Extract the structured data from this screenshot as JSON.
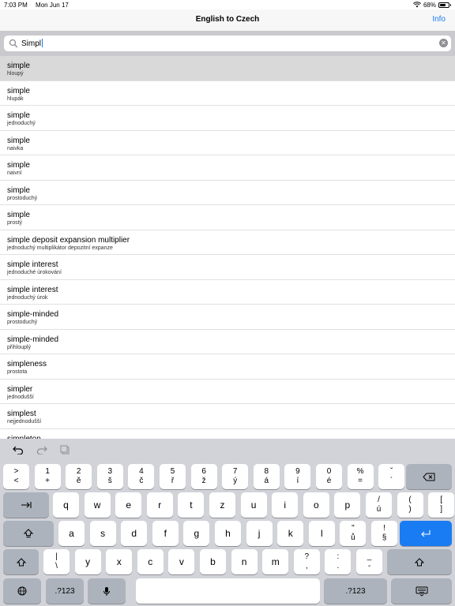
{
  "status_bar": {
    "time": "7:03 PM",
    "date": "Mon Jun 17",
    "battery": "68%",
    "battery_level": 0.68
  },
  "nav": {
    "title": "English to Czech",
    "info_label": "Info"
  },
  "search": {
    "value": "Simpl"
  },
  "results": [
    {
      "term": "simple",
      "translation": "hloupý"
    },
    {
      "term": "simple",
      "translation": "hlupák"
    },
    {
      "term": "simple",
      "translation": "jednoduchý"
    },
    {
      "term": "simple",
      "translation": "naivka"
    },
    {
      "term": "simple",
      "translation": "naivní"
    },
    {
      "term": "simple",
      "translation": "prostoduchý"
    },
    {
      "term": "simple",
      "translation": "prostý"
    },
    {
      "term": "simple deposit expansion multiplier",
      "translation": "jednoduchý multiplikátor depozitní expanze"
    },
    {
      "term": "simple interest",
      "translation": "jednoduché úrokování"
    },
    {
      "term": "simple interest",
      "translation": "jednoduchý úrok"
    },
    {
      "term": "simple-minded",
      "translation": "prostoduchý"
    },
    {
      "term": "simple-minded",
      "translation": "přihlouplý"
    },
    {
      "term": "simpleness",
      "translation": "prostota"
    },
    {
      "term": "simpler",
      "translation": "jednodušší"
    },
    {
      "term": "simplest",
      "translation": "nejjednodušší"
    },
    {
      "term": "simpleton",
      "translation": ""
    }
  ],
  "keyboard": {
    "row1": [
      {
        "top": ">",
        "bottom": "<"
      },
      {
        "top": "1",
        "bottom": "+"
      },
      {
        "top": "2",
        "bottom": "ě"
      },
      {
        "top": "3",
        "bottom": "š"
      },
      {
        "top": "4",
        "bottom": "č"
      },
      {
        "top": "5",
        "bottom": "ř"
      },
      {
        "top": "6",
        "bottom": "ž"
      },
      {
        "top": "7",
        "bottom": "ý"
      },
      {
        "top": "8",
        "bottom": "á"
      },
      {
        "top": "9",
        "bottom": "í"
      },
      {
        "top": "0",
        "bottom": "é"
      },
      {
        "top": "%",
        "bottom": "="
      },
      {
        "top": "ˇ",
        "bottom": "´"
      }
    ],
    "row2": [
      {
        "label": "q"
      },
      {
        "label": "w"
      },
      {
        "label": "e"
      },
      {
        "label": "r"
      },
      {
        "label": "t"
      },
      {
        "label": "z"
      },
      {
        "label": "u"
      },
      {
        "label": "i"
      },
      {
        "label": "o"
      },
      {
        "label": "p"
      },
      {
        "top": "/",
        "bottom": "ú"
      },
      {
        "top": "(",
        "bottom": ")"
      },
      {
        "top": "[",
        "bottom": "]"
      }
    ],
    "row3": [
      {
        "label": "a"
      },
      {
        "label": "s"
      },
      {
        "label": "d"
      },
      {
        "label": "f"
      },
      {
        "label": "g"
      },
      {
        "label": "h"
      },
      {
        "label": "j"
      },
      {
        "label": "k"
      },
      {
        "label": "l"
      },
      {
        "top": "\"",
        "bottom": "ů"
      },
      {
        "top": "!",
        "bottom": "§"
      }
    ],
    "row4": [
      {
        "top": "|",
        "bottom": "\\"
      },
      {
        "label": "y"
      },
      {
        "label": "x"
      },
      {
        "label": "c"
      },
      {
        "label": "v"
      },
      {
        "label": "b"
      },
      {
        "label": "n"
      },
      {
        "label": "m"
      },
      {
        "top": "?",
        "bottom": ","
      },
      {
        "top": ":",
        "bottom": "."
      },
      {
        "top": "_",
        "bottom": "-"
      }
    ],
    "numbers_label": ".?123"
  }
}
